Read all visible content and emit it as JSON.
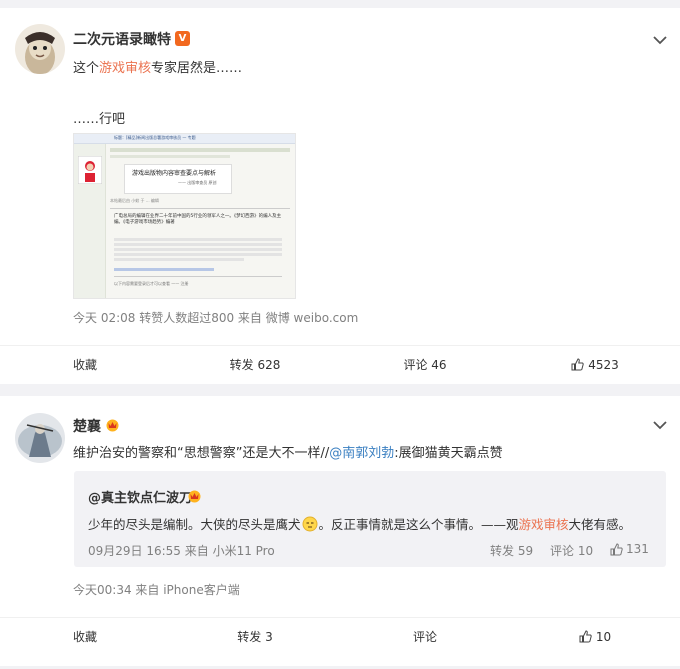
{
  "post1": {
    "username": "二次元语录瞰特",
    "verified_badge": "V",
    "line1_before": "这个",
    "line1_highlight": "游戏审核",
    "line1_after": "专家居然是……",
    "line2": "……行吧",
    "meta": "今天 02:08  转赞人数超过800  来自 微博 weibo.com",
    "actions": {
      "collect": "收藏",
      "repost": "转发 628",
      "comment": "评论 46",
      "like": "4523"
    },
    "thumbnail": {
      "header": "标题：[精品]新闻出版总署游戏审核员 — 专题",
      "title": "游戏出版物内容审查要点与解析",
      "sub": "—— 出版审查员 原创",
      "line_a": "本帖最后由 小蚊 于 ... 编辑",
      "bullet": "广电总局的编辑在业界二十年前中国的5行业的领军人之一。《梦幻西游》的编人及主编。《电子游戏市场趋势》编著",
      "footer": "以下内容需要登录后才可以查看 ——  注册"
    }
  },
  "post2": {
    "username": "楚襄",
    "line1_before": "维护治安的警察和“思想警察”还是大不一样//",
    "line1_mention": "@南郭刘勃",
    "line1_after": ":展御猫黄天霸点赞",
    "repost": {
      "username": "@真主钦点仁波刀",
      "text_before": "少年的尽头是编制。大侠的尽头是鹰犬",
      "text_mid": "。反正事情就是这么个事情。——观",
      "text_highlight": "游戏审核",
      "text_after": "大佬有感。",
      "meta": "09月29日 16:55 来自 小米11 Pro",
      "repost": "转发 59",
      "comment": "评论 10",
      "like": "131"
    },
    "meta": "今天00:34  来自 iPhone客户端",
    "actions": {
      "collect": "收藏",
      "repost": "转发 3",
      "comment": "评论",
      "like": "10"
    }
  },
  "colors": {
    "highlight": "#eb7350",
    "mention": "#3a7fc1",
    "meta": "#808080",
    "background": "#f2f2f5"
  },
  "icons": [
    "chevron-down-icon",
    "repost-icon",
    "comment-icon",
    "like-icon",
    "verified-icon",
    "crown-icon",
    "emoji-icon"
  ]
}
